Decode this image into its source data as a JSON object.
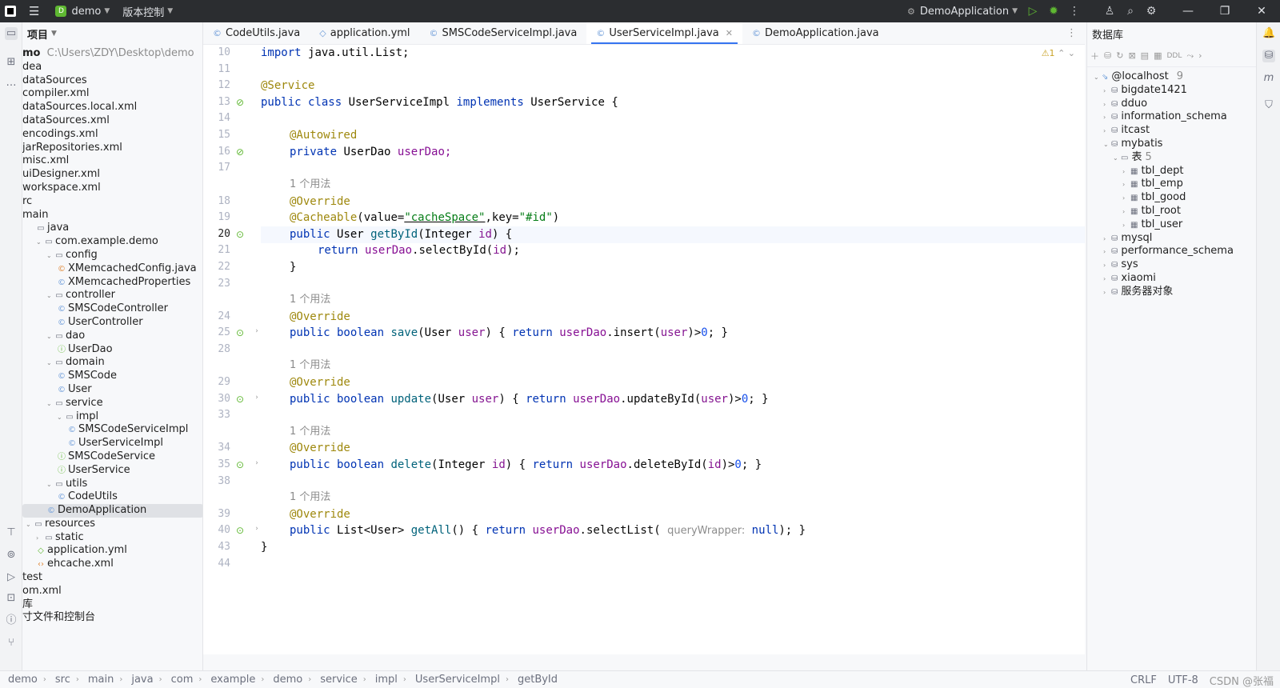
{
  "titlebar": {
    "project": "demo",
    "vcs": "版本控制",
    "run_config": "DemoApplication"
  },
  "project_panel": {
    "title": "项目",
    "root_name": "mo",
    "root_path": "C:\\Users\\ZDY\\Desktop\\demo",
    "tree": [
      {
        "indent": 0,
        "icon": "",
        "label": "dea"
      },
      {
        "indent": 0,
        "icon": "",
        "label": "dataSources"
      },
      {
        "indent": 0,
        "icon": "",
        "label": "compiler.xml"
      },
      {
        "indent": 0,
        "icon": "",
        "label": "dataSources.local.xml"
      },
      {
        "indent": 0,
        "icon": "",
        "label": "dataSources.xml"
      },
      {
        "indent": 0,
        "icon": "",
        "label": "encodings.xml"
      },
      {
        "indent": 0,
        "icon": "",
        "label": "jarRepositories.xml"
      },
      {
        "indent": 0,
        "icon": "",
        "label": "misc.xml"
      },
      {
        "indent": 0,
        "icon": "",
        "label": "uiDesigner.xml"
      },
      {
        "indent": 0,
        "icon": "",
        "label": "workspace.xml"
      },
      {
        "indent": 0,
        "icon": "",
        "label": "rc"
      },
      {
        "indent": 0,
        "icon": "",
        "label": "main"
      },
      {
        "indent": 1,
        "icon": "folder",
        "label": "java"
      },
      {
        "indent": 1,
        "icon": "pkg",
        "label": "com.example.demo"
      },
      {
        "indent": 2,
        "icon": "pkg",
        "label": "config"
      },
      {
        "indent": 3,
        "icon": "cfg",
        "label": "XMemcachedConfig.java"
      },
      {
        "indent": 3,
        "icon": "class",
        "label": "XMemcachedProperties"
      },
      {
        "indent": 2,
        "icon": "pkg",
        "label": "controller"
      },
      {
        "indent": 3,
        "icon": "class",
        "label": "SMSCodeController"
      },
      {
        "indent": 3,
        "icon": "class",
        "label": "UserController"
      },
      {
        "indent": 2,
        "icon": "pkg",
        "label": "dao"
      },
      {
        "indent": 3,
        "icon": "iface",
        "label": "UserDao"
      },
      {
        "indent": 2,
        "icon": "pkg",
        "label": "domain"
      },
      {
        "indent": 3,
        "icon": "class",
        "label": "SMSCode"
      },
      {
        "indent": 3,
        "icon": "class",
        "label": "User"
      },
      {
        "indent": 2,
        "icon": "pkg",
        "label": "service"
      },
      {
        "indent": 3,
        "icon": "pkg",
        "label": "impl"
      },
      {
        "indent": 4,
        "icon": "class",
        "label": "SMSCodeServiceImpl"
      },
      {
        "indent": 4,
        "icon": "class",
        "label": "UserServiceImpl"
      },
      {
        "indent": 3,
        "icon": "iface",
        "label": "SMSCodeService"
      },
      {
        "indent": 3,
        "icon": "iface",
        "label": "UserService"
      },
      {
        "indent": 2,
        "icon": "pkg",
        "label": "utils"
      },
      {
        "indent": 3,
        "icon": "class",
        "label": "CodeUtils"
      },
      {
        "indent": 2,
        "icon": "app",
        "label": "DemoApplication"
      },
      {
        "indent": 0,
        "icon": "folder",
        "label": "resources"
      },
      {
        "indent": 1,
        "icon": "folder",
        "label": "static"
      },
      {
        "indent": 1,
        "icon": "yml",
        "label": "application.yml"
      },
      {
        "indent": 1,
        "icon": "xml",
        "label": "ehcache.xml"
      },
      {
        "indent": 0,
        "icon": "",
        "label": "test"
      },
      {
        "indent": 0,
        "icon": "",
        "label": "om.xml"
      },
      {
        "indent": 0,
        "icon": "",
        "label": "库"
      },
      {
        "indent": 0,
        "icon": "",
        "label": "寸文件和控制台"
      }
    ]
  },
  "editor": {
    "tabs": [
      {
        "label": "CodeUtils.java",
        "active": false
      },
      {
        "label": "application.yml",
        "active": false
      },
      {
        "label": "SMSCodeServiceImpl.java",
        "active": false
      },
      {
        "label": "UserServiceImpl.java",
        "active": true
      },
      {
        "label": "DemoApplication.java",
        "active": false
      }
    ],
    "inspection": "⚠1",
    "usage_hint": "1 个用法",
    "param_hint": "queryWrapper:",
    "line_numbers": [
      "10",
      "11",
      "12",
      "13",
      "14",
      "15",
      "16",
      "17",
      "18",
      "19",
      "20",
      "21",
      "22",
      "23",
      "24",
      "25",
      "28",
      "29",
      "30",
      "33",
      "34",
      "35",
      "38",
      "39",
      "40",
      "43",
      "44"
    ],
    "code": {
      "l10": [
        "import",
        "java.util.List;"
      ],
      "l12": "@Service",
      "l13": [
        "public class",
        "UserServiceImpl",
        "implements",
        "UserService",
        "{"
      ],
      "l15": "@Autowired",
      "l16": [
        "private",
        "UserDao",
        "userDao;"
      ],
      "l18": "@Override",
      "l19_a": "@Cacheable",
      "l19_b": "(value=",
      "l19_c": "\"cacheSpace\"",
      "l19_d": ",key=",
      "l19_e": "\"#id\"",
      "l19_f": ")",
      "l20": [
        "public",
        "User",
        "getById",
        "(",
        "Integer",
        "id",
        ") {"
      ],
      "l21": [
        "return",
        "userDao",
        "selectById",
        "id"
      ],
      "l22": "}",
      "save": [
        "public boolean",
        "save",
        "User",
        "user",
        "return",
        "userDao",
        "insert",
        "user",
        "0"
      ],
      "update": [
        "public boolean",
        "update",
        "User",
        "user",
        "return",
        "userDao",
        "updateById",
        "user",
        "0"
      ],
      "delete": [
        "public boolean",
        "delete",
        "Integer",
        "id",
        "return",
        "userDao",
        "deleteById",
        "id",
        "0"
      ],
      "getall": [
        "public",
        "List",
        "User",
        "getAll",
        "return",
        "userDao",
        "selectList",
        "null"
      ],
      "l43": "}"
    }
  },
  "database_panel": {
    "title": "数据库",
    "ddl": "DDL",
    "host": "@localhost",
    "host_count": "9",
    "tables_label": "表",
    "tables_count": "5",
    "items": [
      {
        "indent": 1,
        "label": "bigdate1421",
        "expanded": false
      },
      {
        "indent": 1,
        "label": "dduo",
        "expanded": false
      },
      {
        "indent": 1,
        "label": "information_schema",
        "expanded": false
      },
      {
        "indent": 1,
        "label": "itcast",
        "expanded": false
      },
      {
        "indent": 1,
        "label": "mybatis",
        "expanded": true
      }
    ],
    "tables": [
      "tbl_dept",
      "tbl_emp",
      "tbl_good",
      "tbl_root",
      "tbl_user"
    ],
    "after": [
      "mysql",
      "performance_schema",
      "sys",
      "xiaomi",
      "服务器对象"
    ]
  },
  "statusbar": {
    "breadcrumbs": [
      "demo",
      "src",
      "main",
      "java",
      "com",
      "example",
      "demo",
      "service",
      "impl",
      "UserServiceImpl",
      "getById"
    ],
    "line_sep": "CRLF",
    "encoding": "UTF-8",
    "watermark": "CSDN @张福"
  }
}
